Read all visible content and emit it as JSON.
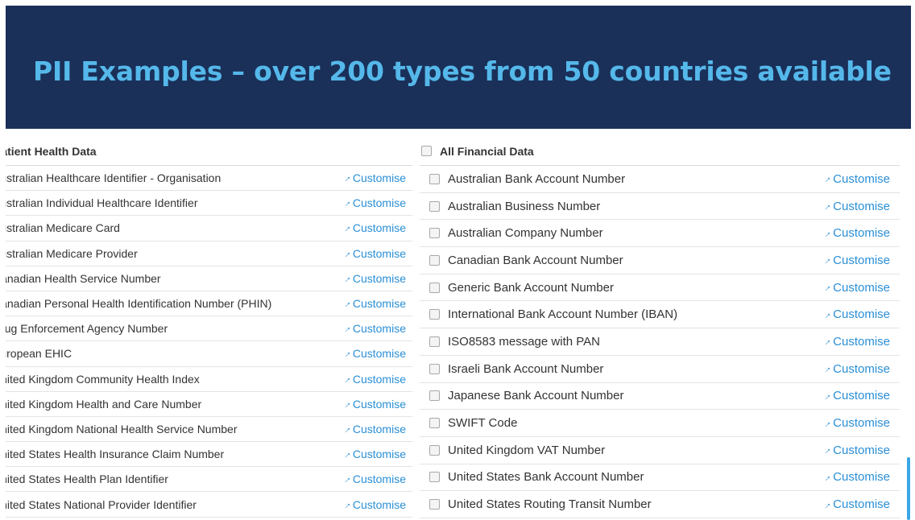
{
  "banner": {
    "title": "PII Examples – over 200 types from 50 countries available"
  },
  "health": {
    "header": "Patient Health Data",
    "customise_label": "Customise",
    "items": [
      "Australian Healthcare Identifier - Organisation",
      "Australian Individual Healthcare Identifier",
      "Australian Medicare Card",
      "Australian Medicare Provider",
      "Canadian Health Service Number",
      "Canadian Personal Health Identification Number (PHIN)",
      "Drug Enforcement Agency Number",
      "European EHIC",
      "United Kingdom Community Health Index",
      "United Kingdom Health and Care Number",
      "United Kingdom National Health Service Number",
      "United States Health Insurance Claim Number",
      "United States Health Plan Identifier",
      "United States National Provider Identifier"
    ]
  },
  "financial": {
    "header": "All Financial Data",
    "customise_label": "Customise",
    "items": [
      "Australian Bank Account Number",
      "Australian Business Number",
      "Australian Company Number",
      "Canadian Bank Account Number",
      "Generic Bank Account Number",
      "International Bank Account Number (IBAN)",
      "ISO8583 message with PAN",
      "Israeli Bank Account Number",
      "Japanese Bank Account Number",
      "SWIFT Code",
      "United Kingdom VAT Number",
      "United States Bank Account Number",
      "United States Routing Transit Number"
    ]
  },
  "icons": {
    "customise": "wrench-icon",
    "checkbox": "checkbox-icon"
  },
  "colors": {
    "banner": "#1a3059",
    "title": "#55b8ea",
    "link": "#2a8fd6"
  }
}
